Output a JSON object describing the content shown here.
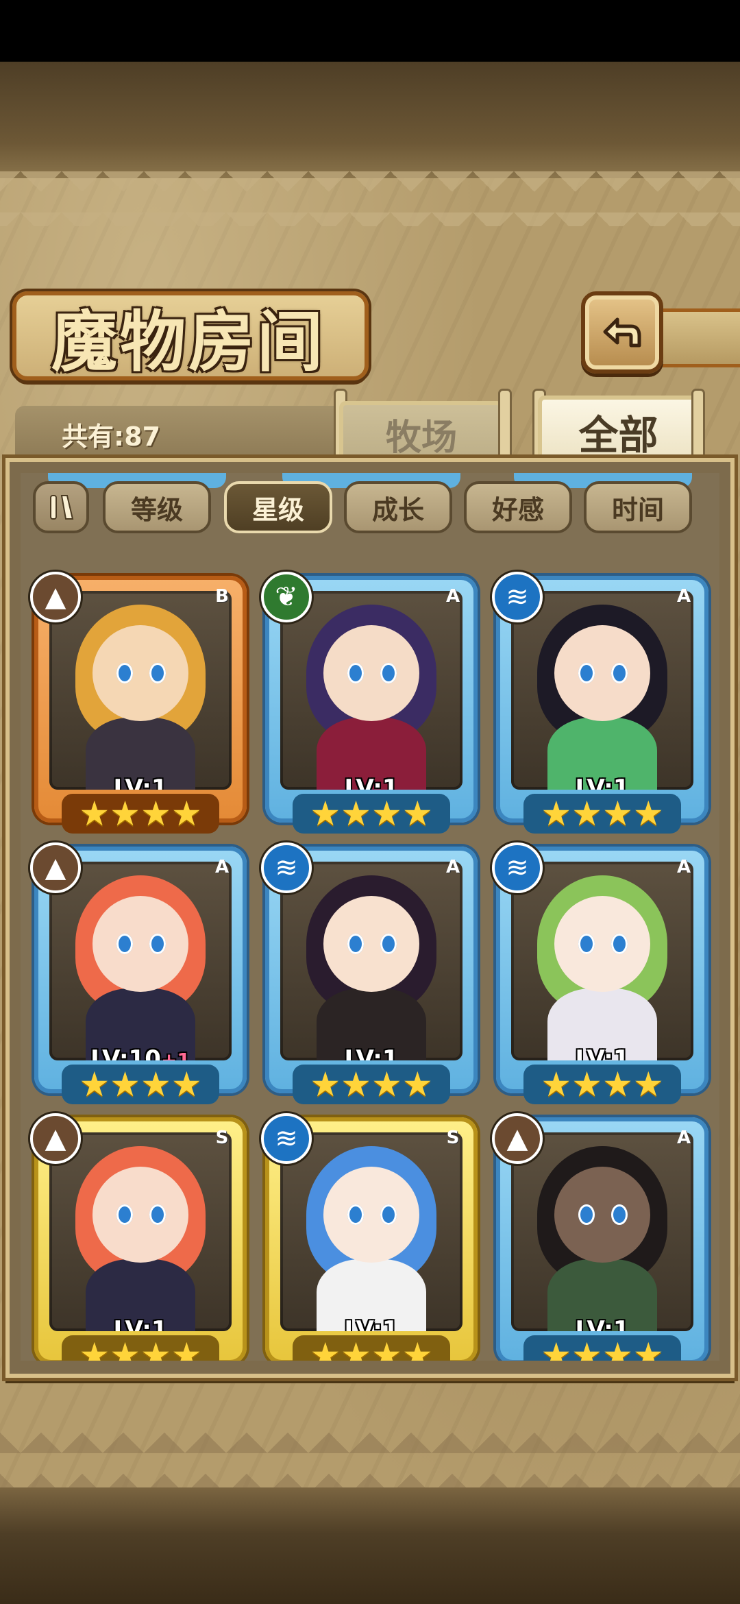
{
  "title": "魔物房间",
  "count_label": "共有:87",
  "tabs": {
    "ranch": "牧场",
    "all": "全部"
  },
  "sort_buttons": [
    "等级",
    "星级",
    "成长",
    "好感",
    "时间"
  ],
  "active_sort": "星级",
  "monsters": [
    {
      "frame": "orange",
      "rank": "B",
      "element": "earth",
      "level": "LV:1",
      "stars": "★★★★",
      "hair": "#e2a43a",
      "skin": "#f5d7b4",
      "outfit": "#3a3340"
    },
    {
      "frame": "blue",
      "rank": "A",
      "element": "leaf",
      "level": "LV:1",
      "stars": "★★★★",
      "hair": "#3b2c63",
      "skin": "#f5dcc7",
      "outfit": "#8b1e3a"
    },
    {
      "frame": "blue",
      "rank": "A",
      "element": "water",
      "level": "LV:1",
      "stars": "★★★★",
      "hair": "#1d1a26",
      "skin": "#f6dcc9",
      "outfit": "#4fb46b"
    },
    {
      "frame": "blue",
      "rank": "A",
      "element": "earth",
      "level": "LV:10",
      "level_plus": "+1",
      "stars": "★★★★",
      "hair": "#ee6a4a",
      "skin": "#f8dccb",
      "outfit": "#2c2a44"
    },
    {
      "frame": "blue",
      "rank": "A",
      "element": "water",
      "level": "LV:1",
      "stars": "★★★★",
      "hair": "#2a1c2e",
      "skin": "#f8e1cf",
      "outfit": "#2b2424"
    },
    {
      "frame": "blue",
      "rank": "A",
      "element": "water",
      "level": "LV:1",
      "stars": "★★★★",
      "hair": "#8bc45a",
      "skin": "#f9e8dc",
      "outfit": "#e9e6ee"
    },
    {
      "frame": "gold",
      "rank": "S",
      "element": "earth",
      "level": "LV:1",
      "stars": "★★★★",
      "hair": "#ee6a4a",
      "skin": "#f8dccb",
      "outfit": "#2c2a44"
    },
    {
      "frame": "gold",
      "rank": "S",
      "element": "water",
      "level": "LV:1",
      "stars": "★★★★",
      "hair": "#4b8fe0",
      "skin": "#f9e8dc",
      "outfit": "#f2f2f2"
    },
    {
      "frame": "blue",
      "rank": "A",
      "element": "earth",
      "level": "LV:1",
      "stars": "★★★★",
      "hair": "#1f1a1a",
      "skin": "#7b6252",
      "outfit": "#3c5a3c"
    }
  ]
}
